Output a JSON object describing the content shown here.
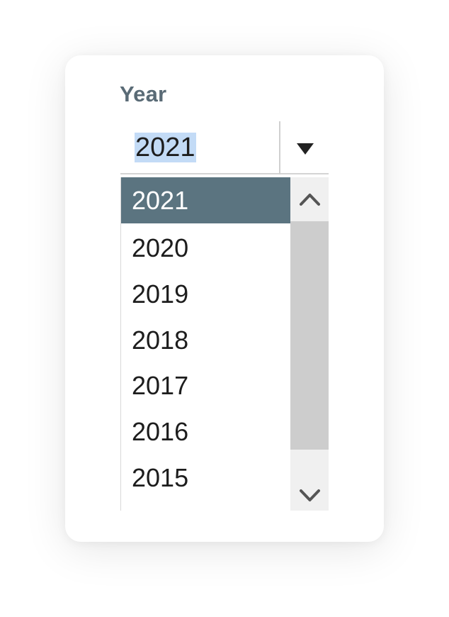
{
  "field": {
    "label": "Year",
    "value": "2021"
  },
  "dropdown": {
    "toggle_icon": "caret-down-icon",
    "options": [
      {
        "label": "2021",
        "selected": true
      },
      {
        "label": "2020",
        "selected": false
      },
      {
        "label": "2019",
        "selected": false
      },
      {
        "label": "2018",
        "selected": false
      },
      {
        "label": "2017",
        "selected": false
      },
      {
        "label": "2016",
        "selected": false
      },
      {
        "label": "2015",
        "selected": false
      }
    ],
    "scrollbar": {
      "up_icon": "chevron-up-icon",
      "down_icon": "chevron-down-icon"
    }
  },
  "colors": {
    "selected_option_bg": "#5b7480",
    "label_text": "#5a6b76",
    "text_selection": "#c3dbf6",
    "scroll_thumb": "#cdcdcd"
  }
}
